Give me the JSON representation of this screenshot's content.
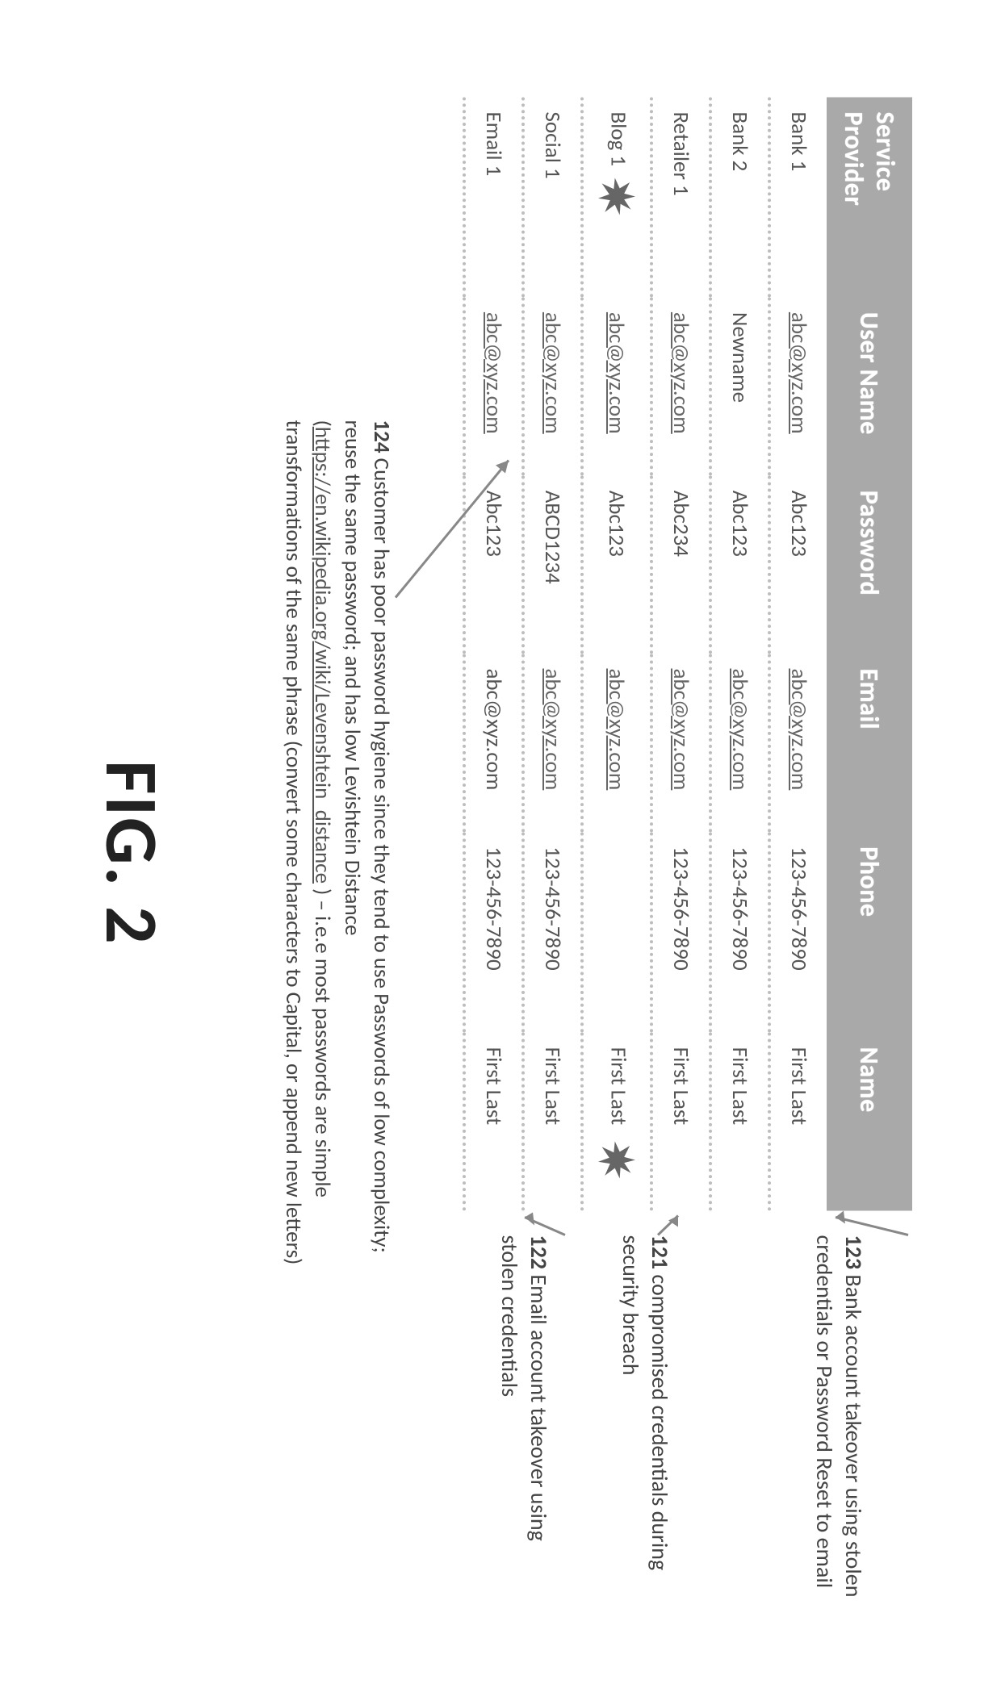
{
  "table": {
    "headers": {
      "serviceProvider": "Service Provider",
      "userName": "User Name",
      "password": "Password",
      "email": "Email",
      "phone": "Phone",
      "name": "Name"
    },
    "rows": [
      {
        "sp": "Bank 1",
        "un": "abc@xyz.com",
        "un_link": true,
        "pw": "Abc123",
        "em": "abc@xyz.com",
        "em_link": true,
        "ph": "123-456-7890",
        "nm": "First Last",
        "burst_sp": false,
        "burst_nm": false
      },
      {
        "sp": "Bank 2",
        "un": "Newname",
        "un_link": false,
        "pw": "Abc123",
        "em": "abc@xyz.com",
        "em_link": true,
        "ph": "123-456-7890",
        "nm": "First Last",
        "burst_sp": false,
        "burst_nm": false
      },
      {
        "sp": "Retailer 1",
        "un": "abc@xyz.com",
        "un_link": true,
        "pw": "Abc234",
        "em": "abc@xyz.com",
        "em_link": true,
        "ph": "123-456-7890",
        "nm": "First Last",
        "burst_sp": false,
        "burst_nm": false
      },
      {
        "sp": "Blog 1",
        "un": "abc@xyz.com",
        "un_link": true,
        "pw": "Abc123",
        "em": "abc@xyz.com",
        "em_link": true,
        "ph": "",
        "nm": "First Last",
        "burst_sp": true,
        "burst_nm": true
      },
      {
        "sp": "Social 1",
        "un": "abc@xyz.com",
        "un_link": true,
        "pw": "ABCD1234",
        "em": "abc@xyz.com",
        "em_link": true,
        "ph": "123-456-7890",
        "nm": "First Last",
        "burst_sp": false,
        "burst_nm": false
      },
      {
        "sp": "Email 1",
        "un": "abc@xyz.com",
        "un_link": true,
        "pw": "Abc123",
        "em": "abc@xyz.com",
        "em_link": false,
        "ph": "123-456-7890",
        "nm": "First Last",
        "burst_sp": false,
        "burst_nm": false
      }
    ]
  },
  "annot": {
    "a123": {
      "num": "123",
      "text": " Bank account takeover using stolen credentials or Password Reset to email"
    },
    "a121": {
      "num": "121",
      "text": " compromised credentials during security breach"
    },
    "a122": {
      "num": "122",
      "text": " Email account takeover using stolen credentials"
    }
  },
  "note124": {
    "num": "124",
    "text_before": " Customer has poor password hygiene since they tend to use Passwords of low complexity; reuse the same password; and has low Levishtein Distance (",
    "link_text": "https://en.wikipedia.org/wiki/Levenshtein_distance",
    "text_after": " ) – i.e.e most passwords are simple transformations of the same phrase (convert some characters to Capital, or append new letters)"
  },
  "figure_label": "FIG. 2"
}
